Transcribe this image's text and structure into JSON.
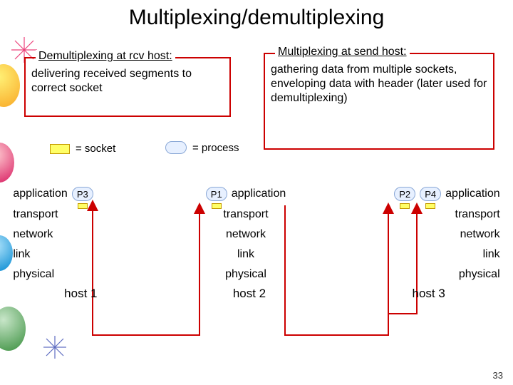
{
  "title": "Multiplexing/demultiplexing",
  "demux_box": {
    "legend": "Demultiplexing at rcv host:",
    "body": "delivering received segments to correct socket"
  },
  "mux_box": {
    "legend": "Multiplexing at send host:",
    "body": "gathering data from multiple sockets, enveloping data with header (later used for demultiplexing)"
  },
  "legend": {
    "socket": "= socket",
    "process": "= process"
  },
  "layers": {
    "application": "application",
    "transport": "transport",
    "network": "network",
    "link": "link",
    "physical": "physical"
  },
  "processes": {
    "p1": "P1",
    "p2": "P2",
    "p3": "P3",
    "p4": "P4"
  },
  "hosts": {
    "h1": "host 1",
    "h2": "host 2",
    "h3": "host 3"
  },
  "slide_number": "33"
}
